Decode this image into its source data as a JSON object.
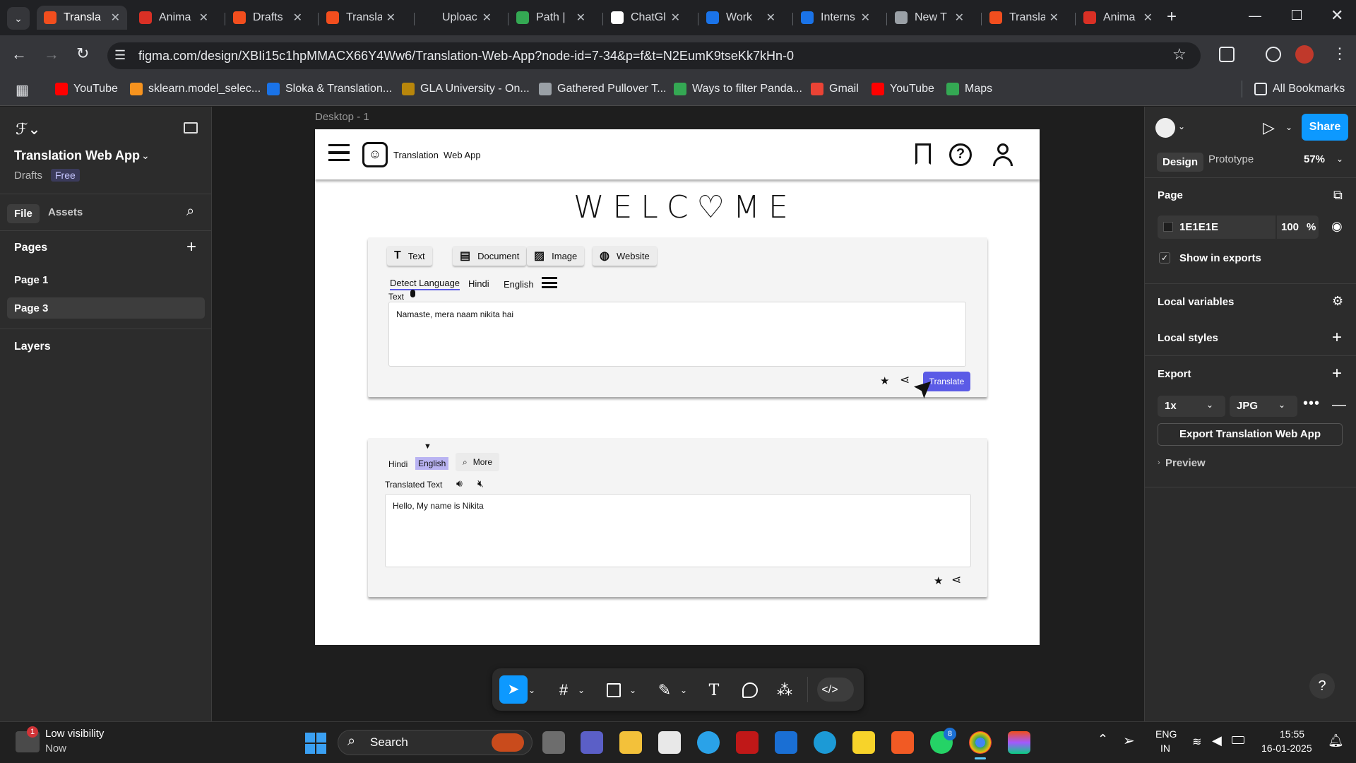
{
  "tabs": [
    {
      "title": "Transla",
      "color": "#f24e1e",
      "active": true
    },
    {
      "title": "Anima",
      "color": "#d93025"
    },
    {
      "title": "Drafts",
      "color": "#f24e1e"
    },
    {
      "title": "Transla",
      "color": "#f24e1e"
    },
    {
      "title": "Uploac",
      "color": "#202124"
    },
    {
      "title": "Path |",
      "color": "#34a853"
    },
    {
      "title": "ChatGl",
      "color": "#ffffff"
    },
    {
      "title": "Work",
      "color": "#1a73e8"
    },
    {
      "title": "Interns",
      "color": "#1a73e8"
    },
    {
      "title": "New T",
      "color": "#9aa0a6"
    },
    {
      "title": "Transla",
      "color": "#f24e1e"
    },
    {
      "title": "Anima",
      "color": "#d93025"
    }
  ],
  "address": {
    "url": "figma.com/design/XBIi15c1hpMMACX66Y4Ww6/Translation-Web-App?node-id=7-34&p=f&t=N2EumK9tseKk7kHn-0"
  },
  "bookmarks": [
    {
      "label": "YouTube",
      "color": "#ff0000"
    },
    {
      "label": "sklearn.model_selec...",
      "color": "#f7931e"
    },
    {
      "label": "Sloka & Translation...",
      "color": "#1a73e8"
    },
    {
      "label": "GLA University - On...",
      "color": "#b8860b"
    },
    {
      "label": "Gathered Pullover T...",
      "color": "#9aa0a6"
    },
    {
      "label": "Ways to filter Panda...",
      "color": "#34a853"
    },
    {
      "label": "Gmail",
      "color": "#ea4335"
    },
    {
      "label": "YouTube",
      "color": "#ff0000"
    },
    {
      "label": "Maps",
      "color": "#34a853"
    }
  ],
  "all_bookmarks": "All Bookmarks",
  "figma": {
    "project": "Translation Web App",
    "drafts": "Drafts",
    "plan": "Free",
    "file_tab": "File",
    "assets_tab": "Assets",
    "pages_label": "Pages",
    "pages": [
      "Page 1",
      "Page 3"
    ],
    "layers_label": "Layers",
    "frame_label": "Desktop - 1",
    "design_tab": "Design",
    "prototype_tab": "Prototype",
    "zoom": "57%",
    "share": "Share",
    "page_section": "Page",
    "page_color": "1E1E1E",
    "page_opacity": "100",
    "percent": "%",
    "show_in_exports": "Show in exports",
    "local_variables": "Local variables",
    "local_styles": "Local styles",
    "export": "Export",
    "export_scale": "1x",
    "export_format": "JPG",
    "export_button": "Export Translation Web App",
    "preview": "Preview"
  },
  "app": {
    "brand": "Translation  Web App",
    "welcome_left": "WELC",
    "welcome_right": "ME",
    "modes": [
      "Text",
      "Document",
      "Image",
      "Website"
    ],
    "source_langs": [
      "Detect Language",
      "Hindi",
      "English"
    ],
    "input_label": "Text",
    "input_text": "Namaste, mera naam nikita hai",
    "translate": "Translate",
    "target_langs": [
      "Hindi",
      "English"
    ],
    "more": "More",
    "output_label": "Translated Text",
    "output_text": "Hello, My name is Nikita"
  },
  "taskbar": {
    "weather_title": "Low visibility",
    "weather_sub": "Now",
    "weather_badge": "1",
    "search": "Search",
    "lang1": "ENG",
    "lang2": "IN",
    "time": "15:55",
    "date": "16-01-2025",
    "whatsapp_badge": "8"
  }
}
